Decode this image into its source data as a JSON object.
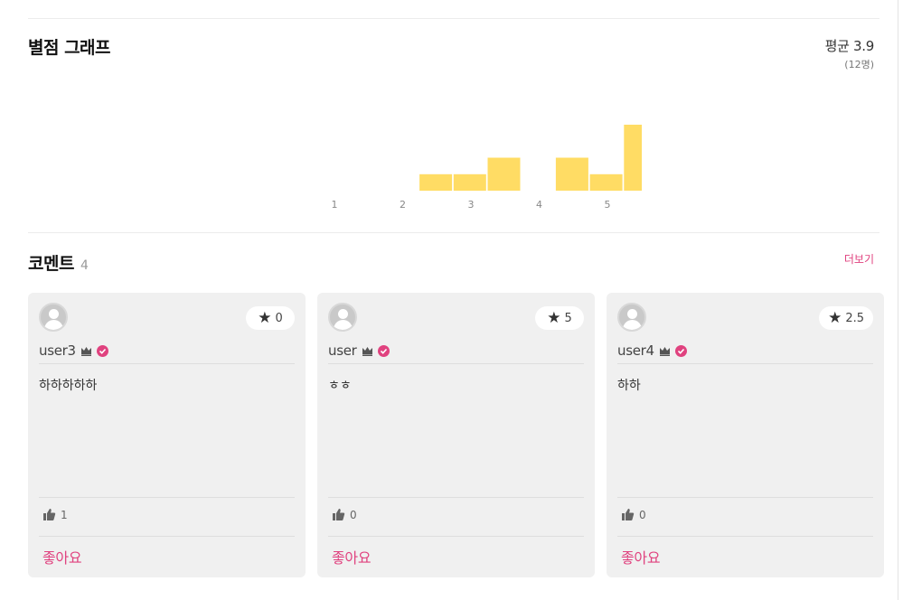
{
  "graph": {
    "title": "별점 그래프",
    "average_label": "평균 3.9",
    "count_label": "(12명)"
  },
  "chart_data": {
    "type": "bar",
    "bar_color": "#ffdc64",
    "tick_labels": [
      "1",
      "2",
      "3",
      "4",
      "5"
    ],
    "categories": [
      "0.5",
      "1",
      "1.5",
      "2",
      "2.5",
      "3",
      "3.5",
      "4",
      "4.5",
      "5"
    ],
    "values": [
      0,
      0,
      0,
      1,
      1,
      2,
      0,
      2,
      1,
      4
    ],
    "ylim": [
      0,
      4
    ]
  },
  "comments": {
    "title": "코멘트",
    "count": "4",
    "more_label": "더보기",
    "items": [
      {
        "user": "user3",
        "rating": "0",
        "text": "하하하하하",
        "likes": "1",
        "like_label": "좋아요"
      },
      {
        "user": "user",
        "rating": "5",
        "text": "ㅎㅎ",
        "likes": "0",
        "like_label": "좋아요"
      },
      {
        "user": "user4",
        "rating": "2.5",
        "text": "하하",
        "likes": "0",
        "like_label": "좋아요"
      }
    ]
  },
  "colors": {
    "accent": "#e0427f",
    "bar": "#ffdc64",
    "card_bg": "#f0f0f0"
  },
  "icons": {
    "star": "star-icon",
    "crown": "crown-icon",
    "verified": "verified-badge-icon",
    "thumb": "thumbs-up-icon",
    "avatar": "default-avatar-icon"
  }
}
